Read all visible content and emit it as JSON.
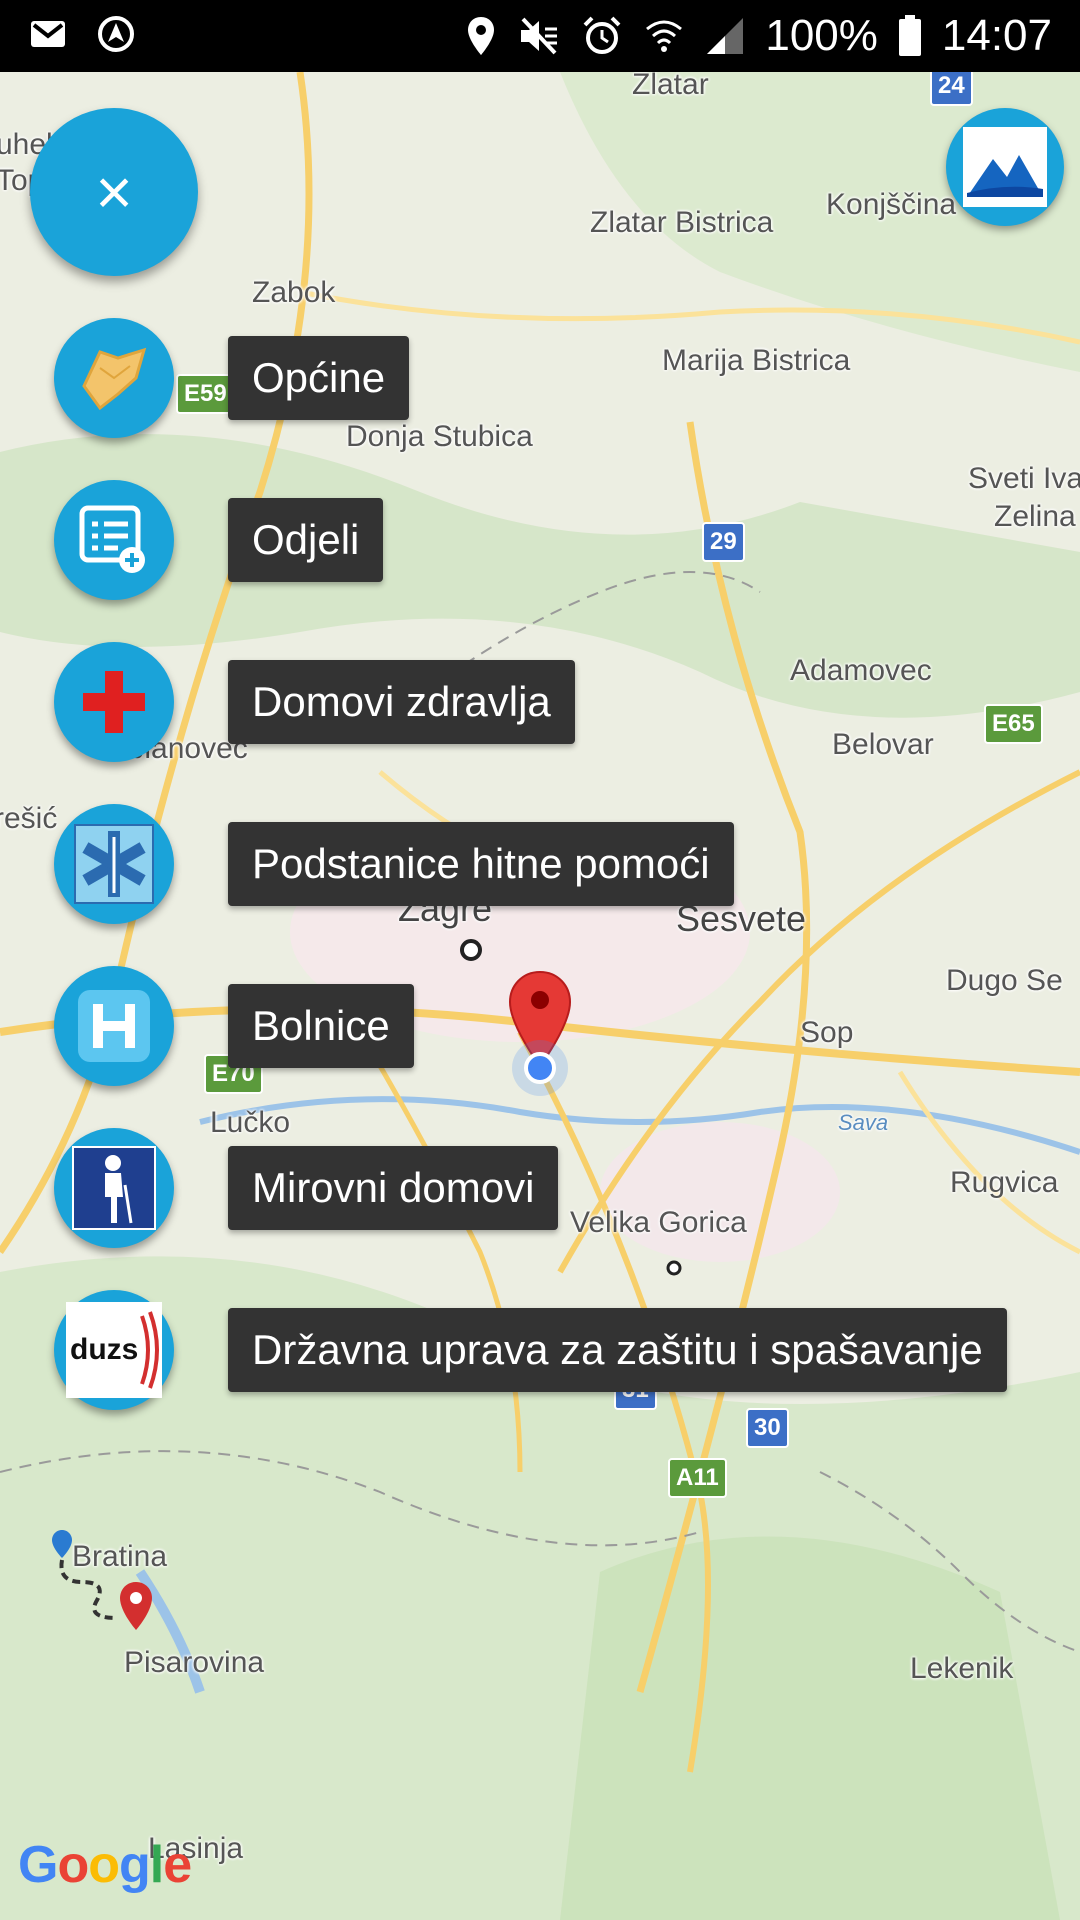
{
  "status_bar": {
    "battery": "100%",
    "time": "14:07"
  },
  "map": {
    "places": [
      {
        "name": "Zlatar"
      },
      {
        "name": "Zlatar Bistrica"
      },
      {
        "name": "Konjščina"
      },
      {
        "name": "Zabok"
      },
      {
        "name": "Marija Bistrica"
      },
      {
        "name": "Donja Stubica"
      },
      {
        "name": "Sveti Iva"
      },
      {
        "name": "Zelina"
      },
      {
        "name": "Adamovec"
      },
      {
        "name": "Belovar"
      },
      {
        "name": "Jablanovec"
      },
      {
        "name": "rešić"
      },
      {
        "name": "Zagre"
      },
      {
        "name": "Sesvete"
      },
      {
        "name": "Dugo Se"
      },
      {
        "name": "Sop"
      },
      {
        "name": "Lučko"
      },
      {
        "name": "Sava"
      },
      {
        "name": "Rugvica"
      },
      {
        "name": "Velika Gorica"
      },
      {
        "name": "Bratina"
      },
      {
        "name": "Pisarovina"
      },
      {
        "name": "Lekenik"
      },
      {
        "name": "Lasinja"
      },
      {
        "name": "uhel"
      },
      {
        "name": "Top"
      }
    ],
    "shields": [
      {
        "label": "24"
      },
      {
        "label": "E59"
      },
      {
        "label": "29"
      },
      {
        "label": "E65"
      },
      {
        "label": "E70"
      },
      {
        "label": "31"
      },
      {
        "label": "30"
      },
      {
        "label": "A11"
      }
    ],
    "attribution": "Google"
  },
  "fab_menu": {
    "close_symbol": "×",
    "items": [
      {
        "label": "Općine",
        "icon": "municipality-map-icon"
      },
      {
        "label": "Odjeli",
        "icon": "departments-list-icon"
      },
      {
        "label": "Domovi zdravlja",
        "icon": "red-cross-icon"
      },
      {
        "label": "Podstanice hitne pomoći",
        "icon": "star-of-life-icon"
      },
      {
        "label": "Bolnice",
        "icon": "hospital-h-icon"
      },
      {
        "label": "Mirovni domovi",
        "icon": "elderly-person-icon"
      },
      {
        "label": "Državna uprava za zaštitu i spašavanje",
        "icon": "duzs-logo-icon"
      }
    ],
    "duzs_logo_text": "duzs"
  },
  "colors": {
    "fab": "#1aa3d9",
    "label_bg": "#333333",
    "pin": "#e53935",
    "location": "#4285f4"
  }
}
